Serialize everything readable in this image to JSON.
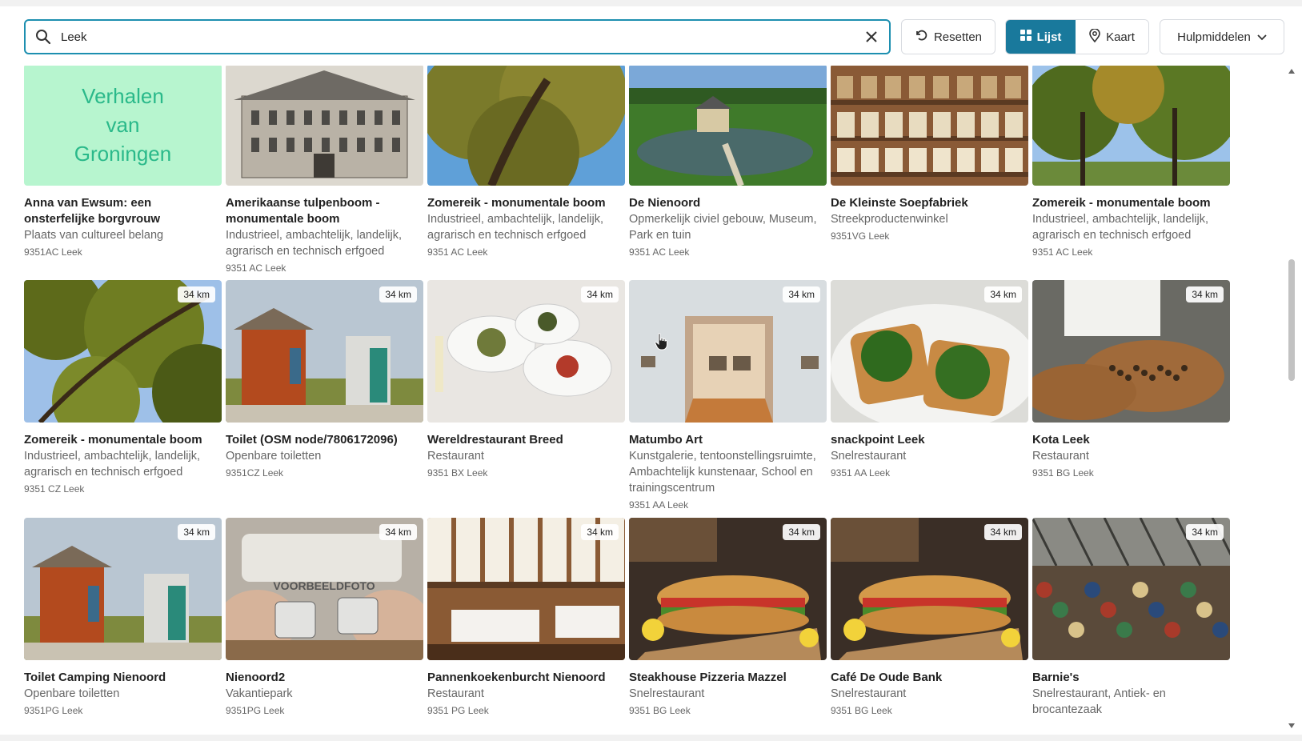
{
  "search": {
    "value": "Leek",
    "placeholder": ""
  },
  "toolbar": {
    "reset_label": "Resetten",
    "list_label": "Lijst",
    "map_label": "Kaart",
    "tools_label": "Hulpmiddelen"
  },
  "colors": {
    "accent": "#19799c",
    "search_border": "#1d8fb0"
  },
  "cards": [
    {
      "title": "Anna van Ewsum: een onsterfelijke borgvrouw",
      "category": "Plaats van cultureel belang",
      "address": "9351AC Leek",
      "distance": "",
      "image": "verhalen-van-groningen-tile",
      "image_text": [
        "Verhalen",
        "van",
        "Groningen"
      ]
    },
    {
      "title": "Amerikaanse tulpenboom - monumentale boom",
      "category": "Industrieel, ambachtelijk, landelijk, agrarisch en technisch erfgoed",
      "address": "9351 AC Leek",
      "distance": "",
      "image": "castle-drawing"
    },
    {
      "title": "Zomereik - monumentale boom",
      "category": "Industrieel, ambachtelijk, landelijk, agrarisch en technisch erfgoed",
      "address": "9351 AC Leek",
      "distance": "",
      "image": "oak-tree"
    },
    {
      "title": "De Nienoord",
      "category": "Opmerkelijk civiel gebouw, Museum, Park en tuin",
      "address": "9351 AC Leek",
      "distance": "",
      "image": "estate-aerial"
    },
    {
      "title": "De Kleinste Soepfabriek",
      "category": "Streekproductenwinkel",
      "address": "9351VG Leek",
      "distance": "",
      "image": "shop-shelves"
    },
    {
      "title": "Zomereik - monumentale boom",
      "category": "Industrieel, ambachtelijk, landelijk, agrarisch en technisch erfgoed",
      "address": "9351 AC Leek",
      "distance": "",
      "image": "forest"
    },
    {
      "title": "Zomereik - monumentale boom",
      "category": "Industrieel, ambachtelijk, landelijk, agrarisch en technisch erfgoed",
      "address": "9351 CZ Leek",
      "distance": "34 km",
      "image": "oak-leaves"
    },
    {
      "title": "Toilet (OSM node/7806172096)",
      "category": "Openbare toiletten",
      "address": "9351CZ Leek",
      "distance": "34 km",
      "image": "toilet-hut"
    },
    {
      "title": "Wereldrestaurant Breed",
      "category": "Restaurant",
      "address": "9351 BX Leek",
      "distance": "34 km",
      "image": "plates"
    },
    {
      "title": "Matumbo Art",
      "category": "Kunstgalerie, tentoonstellingsruimte, Ambachtelijk kunstenaar, School en trainingscentrum",
      "address": "9351 AA Leek",
      "distance": "34 km",
      "image": "gallery"
    },
    {
      "title": "snackpoint Leek",
      "category": "Snelrestaurant",
      "address": "9351 AA Leek",
      "distance": "34 km",
      "image": "avocado-toast"
    },
    {
      "title": "Kota Leek",
      "category": "Restaurant",
      "address": "9351 BG Leek",
      "distance": "34 km",
      "image": "chef-plating"
    },
    {
      "title": "Toilet Camping Nienoord",
      "category": "Openbare toiletten",
      "address": "9351PG Leek",
      "distance": "34 km",
      "image": "toilet-hut"
    },
    {
      "title": "Nienoord2",
      "category": "Vakantiepark",
      "address": "9351PG Leek",
      "distance": "34 km",
      "image": "camping-mugs",
      "image_text": [
        "VOORBEELDFOTO"
      ]
    },
    {
      "title": "Pannenkoekenburcht Nienoord",
      "category": "Restaurant",
      "address": "9351 PG Leek",
      "distance": "34 km",
      "image": "restaurant-interior"
    },
    {
      "title": "Steakhouse Pizzeria Mazzel",
      "category": "Snelrestaurant",
      "address": "9351 BG Leek",
      "distance": "34 km",
      "image": "sandwich"
    },
    {
      "title": "Café De Oude Bank",
      "category": "Snelrestaurant",
      "address": "9351 BG Leek",
      "distance": "34 km",
      "image": "sandwich"
    },
    {
      "title": "Barnie's",
      "category": "Snelrestaurant, Antiek- en brocantezaak",
      "address": "",
      "distance": "34 km",
      "image": "market-hall"
    }
  ]
}
